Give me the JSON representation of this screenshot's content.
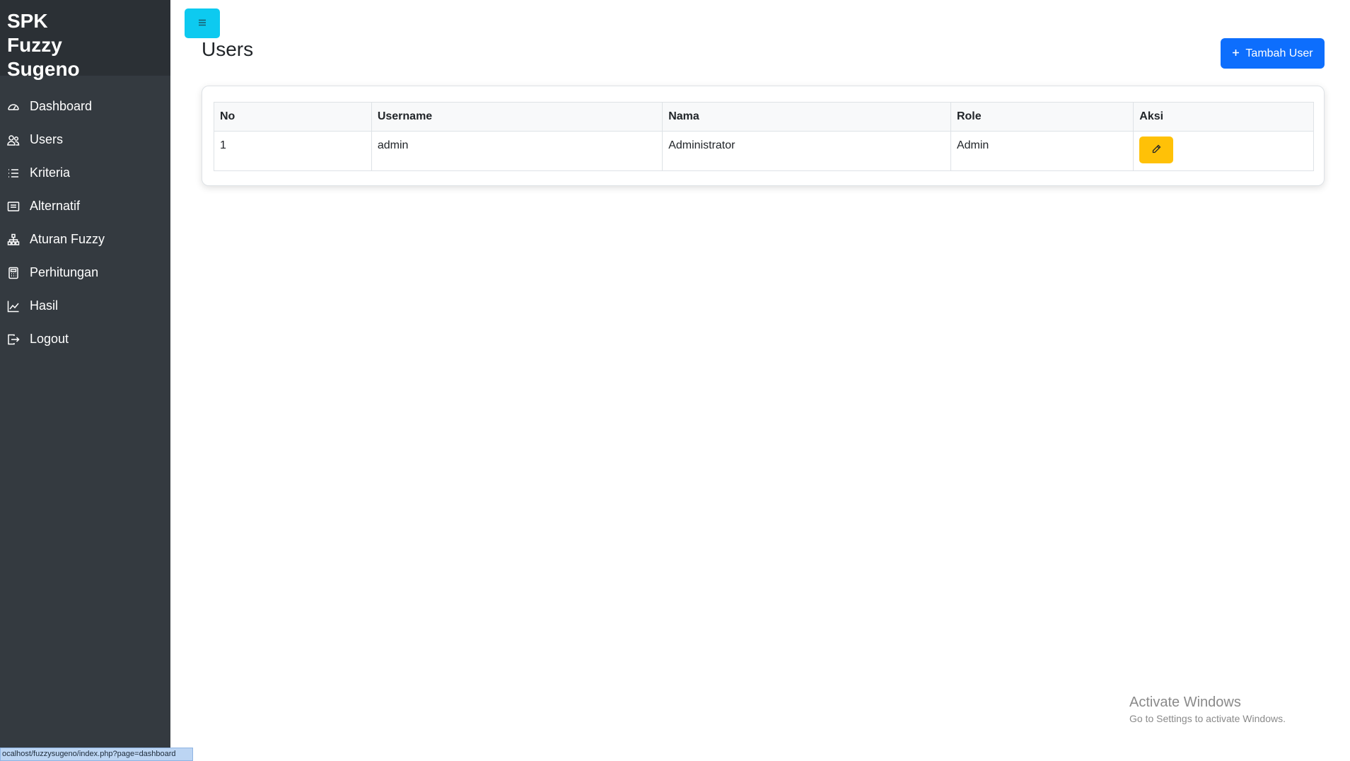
{
  "sidebar": {
    "brand": "SPK Fuzzy Sugeno",
    "items": [
      {
        "label": "Dashboard",
        "icon": "speedometer-icon"
      },
      {
        "label": "Users",
        "icon": "people-icon"
      },
      {
        "label": "Kriteria",
        "icon": "list-icon"
      },
      {
        "label": "Alternatif",
        "icon": "card-list-icon"
      },
      {
        "label": "Aturan Fuzzy",
        "icon": "diagram-icon"
      },
      {
        "label": "Perhitungan",
        "icon": "calculator-icon"
      },
      {
        "label": "Hasil",
        "icon": "graph-up-icon"
      },
      {
        "label": "Logout",
        "icon": "logout-icon"
      }
    ]
  },
  "header": {
    "title": "Users",
    "add_button": "Tambah User",
    "toggle_icon": "menu-icon"
  },
  "table": {
    "columns": [
      "No",
      "Username",
      "Nama",
      "Role",
      "Aksi"
    ],
    "rows": [
      {
        "no": "1",
        "username": "admin",
        "nama": "Administrator",
        "role": "Admin",
        "action_icon": "pencil-icon"
      }
    ]
  },
  "watermark": {
    "title": "Activate Windows",
    "subtitle": "Go to Settings to activate Windows."
  },
  "status_bar": {
    "url": "ocalhost/fuzzysugeno/index.php?page=dashboard"
  },
  "colors": {
    "sidebar_bg": "#343a40",
    "brand_bg": "#2b3035",
    "primary": "#0d6efd",
    "info": "#0dcaf0",
    "warning": "#ffc107"
  }
}
